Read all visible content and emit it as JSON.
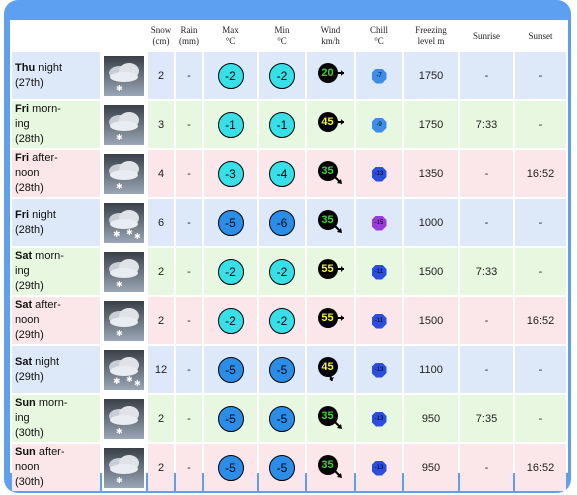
{
  "headers": {
    "period": "",
    "icon": "",
    "snow": [
      "Snow",
      "(cm)"
    ],
    "rain": [
      "Rain",
      "(mm)"
    ],
    "max": [
      "Max",
      "°C"
    ],
    "min": [
      "Min",
      "°C"
    ],
    "wind": [
      "Wind",
      "km/h"
    ],
    "chill": [
      "Chill",
      "°C"
    ],
    "freezing": [
      "Freezing",
      "level m"
    ],
    "sunrise": "Sunrise",
    "sunset": "Sunset"
  },
  "rows": [
    {
      "type": "night",
      "day": "Thu",
      "rest": " night",
      "date": "(27th)",
      "icon": "cloud-snow-light",
      "snow": "2",
      "rain": "-",
      "max": "-2",
      "max_color": "#35e0e8",
      "min": "-2",
      "min_color": "#35e0e8",
      "wind": "20",
      "wind_color": "#3cd23c",
      "wind_dir": "east",
      "chill": "-7",
      "chill_color": "#3b8de8",
      "freezing": "1750",
      "sunrise": "-",
      "sunset": "-"
    },
    {
      "type": "morning",
      "day": "Fri",
      "rest": " morn-",
      "rest2": "ing",
      "date": "(28th)",
      "icon": "cloud-snow-light",
      "snow": "3",
      "rain": "-",
      "max": "-1",
      "max_color": "#35e0e8",
      "min": "-1",
      "min_color": "#35e0e8",
      "wind": "45",
      "wind_color": "#f5f52a",
      "wind_dir": "east",
      "chill": "-9",
      "chill_color": "#3b8de8",
      "freezing": "1750",
      "sunrise": "7:33",
      "sunset": "-"
    },
    {
      "type": "afternoon",
      "day": "Fri",
      "rest": " after-",
      "rest2": "noon",
      "date": "(28th)",
      "icon": "cloud-snow-light",
      "snow": "4",
      "rain": "-",
      "max": "-3",
      "max_color": "#35e0e8",
      "min": "-4",
      "min_color": "#35e0e8",
      "wind": "35",
      "wind_color": "#3cd23c",
      "wind_dir": "southeast",
      "chill": "-13",
      "chill_color": "#2a4fe0",
      "freezing": "1350",
      "sunrise": "-",
      "sunset": "16:52"
    },
    {
      "type": "night",
      "day": "Fri",
      "rest": " night",
      "date": "(28th)",
      "icon": "cloud-snow-heavy",
      "snow": "6",
      "rain": "-",
      "max": "-5",
      "max_color": "#2a8ee8",
      "min": "-6",
      "min_color": "#2a8ee8",
      "wind": "35",
      "wind_color": "#3cd23c",
      "wind_dir": "southeast",
      "chill": "-15",
      "chill_color": "#9a3ad8",
      "freezing": "1000",
      "sunrise": "-",
      "sunset": "-"
    },
    {
      "type": "morning",
      "day": "Sat",
      "rest": " morn-",
      "rest2": "ing",
      "date": "(29th)",
      "icon": "cloud-snow-light",
      "snow": "2",
      "rain": "-",
      "max": "-2",
      "max_color": "#35e0e8",
      "min": "-2",
      "min_color": "#35e0e8",
      "wind": "55",
      "wind_color": "#f5f52a",
      "wind_dir": "east",
      "chill": "-11",
      "chill_color": "#2a4fe0",
      "freezing": "1500",
      "sunrise": "7:33",
      "sunset": "-"
    },
    {
      "type": "afternoon",
      "day": "Sat",
      "rest": " after-",
      "rest2": "noon",
      "date": "(29th)",
      "icon": "cloud-snow-light",
      "snow": "2",
      "rain": "-",
      "max": "-2",
      "max_color": "#35e0e8",
      "min": "-2",
      "min_color": "#35e0e8",
      "wind": "55",
      "wind_color": "#f5f52a",
      "wind_dir": "east",
      "chill": "-11",
      "chill_color": "#2a4fe0",
      "freezing": "1500",
      "sunrise": "-",
      "sunset": "16:52"
    },
    {
      "type": "night",
      "day": "Sat",
      "rest": " night",
      "date": "(29th)",
      "icon": "cloud-snow-heavy",
      "snow": "12",
      "rain": "-",
      "max": "-5",
      "max_color": "#2a8ee8",
      "min": "-5",
      "min_color": "#2a8ee8",
      "wind": "45",
      "wind_color": "#f5f52a",
      "wind_dir": "south",
      "chill": "-13",
      "chill_color": "#2a4fe0",
      "freezing": "1100",
      "sunrise": "-",
      "sunset": "-"
    },
    {
      "type": "morning",
      "day": "Sun",
      "rest": " morn-",
      "rest2": "ing",
      "date": "(30th)",
      "icon": "cloud-snow-light",
      "snow": "2",
      "rain": "-",
      "max": "-5",
      "max_color": "#2a8ee8",
      "min": "-5",
      "min_color": "#2a8ee8",
      "wind": "35",
      "wind_color": "#3cd23c",
      "wind_dir": "southeast",
      "chill": "-13",
      "chill_color": "#2a4fe0",
      "freezing": "950",
      "sunrise": "7:35",
      "sunset": "-"
    },
    {
      "type": "afternoon",
      "day": "Sun",
      "rest": " after-",
      "rest2": "noon",
      "date": "(30th)",
      "icon": "cloud-snow-light",
      "snow": "2",
      "rain": "-",
      "max": "-5",
      "max_color": "#2a8ee8",
      "min": "-5",
      "min_color": "#2a8ee8",
      "wind": "35",
      "wind_color": "#3cd23c",
      "wind_dir": "southeast",
      "chill": "-13",
      "chill_color": "#2a4fe0",
      "freezing": "950",
      "sunrise": "-",
      "sunset": "16:52"
    }
  ]
}
